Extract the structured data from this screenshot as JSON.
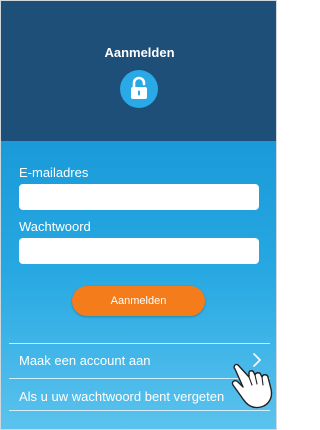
{
  "header": {
    "title": "Aanmelden",
    "icon": "unlock-icon"
  },
  "form": {
    "email_label": "E-mailadres",
    "email_value": "",
    "password_label": "Wachtwoord",
    "password_value": "",
    "submit_label": "Aanmelden"
  },
  "links": {
    "create_account": "Maak een account aan",
    "forgot_password": "Als u uw wachtwoord bent vergeten"
  },
  "colors": {
    "header_bg": "#1d4f79",
    "accent_blue": "#29a9e6",
    "button_orange": "#f47c1b"
  }
}
